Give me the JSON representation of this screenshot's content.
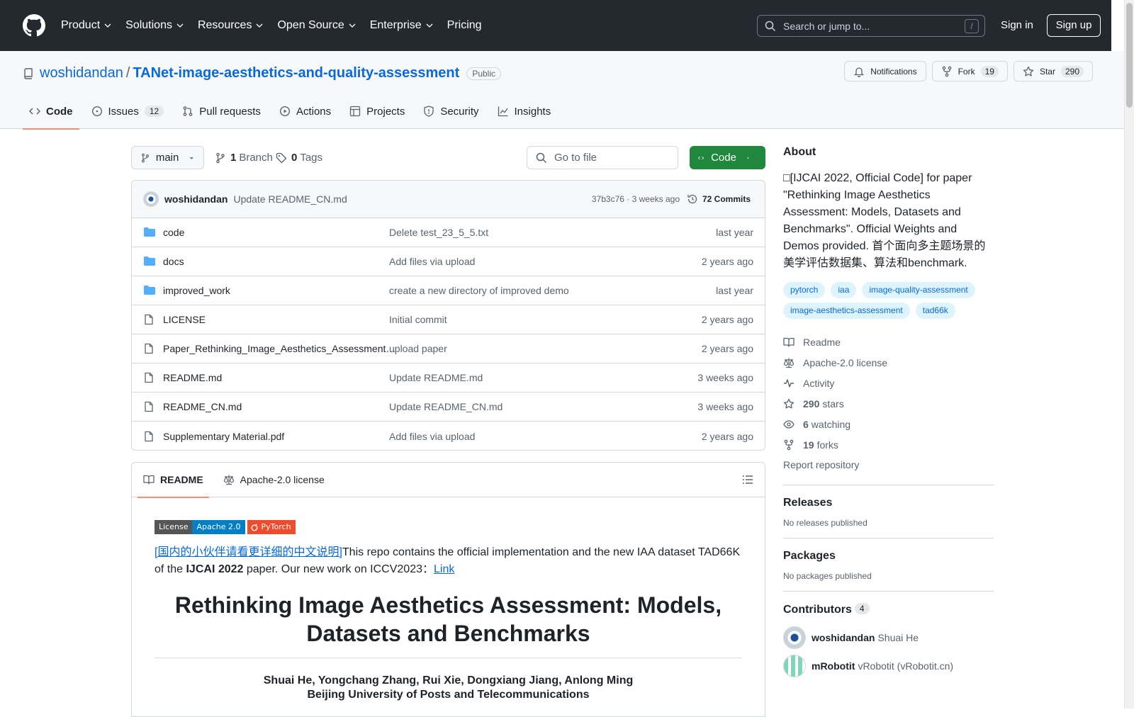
{
  "header": {
    "nav": [
      "Product",
      "Solutions",
      "Resources",
      "Open Source",
      "Enterprise",
      "Pricing"
    ],
    "search_placeholder": "Search or jump to...",
    "search_key": "/",
    "signin": "Sign in",
    "signup": "Sign up"
  },
  "repo": {
    "owner": "woshidandan",
    "separator": "/",
    "name": "TANet-image-aesthetics-and-quality-assessment",
    "visibility": "Public",
    "notifications": "Notifications",
    "fork_label": "Fork",
    "fork_count": "19",
    "star_label": "Star",
    "star_count": "290"
  },
  "tabs": [
    {
      "label": "Code",
      "icon": "code-icon"
    },
    {
      "label": "Issues",
      "count": "12",
      "icon": "issue-icon"
    },
    {
      "label": "Pull requests",
      "icon": "pull-request-icon"
    },
    {
      "label": "Actions",
      "icon": "play-icon"
    },
    {
      "label": "Projects",
      "icon": "table-icon"
    },
    {
      "label": "Security",
      "icon": "shield-icon"
    },
    {
      "label": "Insights",
      "icon": "graph-icon"
    }
  ],
  "toolbar": {
    "branch": "main",
    "branch_count": "1",
    "branch_label": "Branch",
    "tag_count": "0",
    "tag_label": "Tags",
    "goto_placeholder": "Go to file",
    "code_label": "Code"
  },
  "latest_commit": {
    "user": "woshidandan",
    "message": "Update README_CN.md",
    "meta": "37b3c76 · 3 weeks ago",
    "commits": "72 Commits"
  },
  "files": [
    {
      "name": "code",
      "type": "dir",
      "message": "Delete test_23_5_5.txt",
      "time": "last year"
    },
    {
      "name": "docs",
      "type": "dir",
      "message": "Add files via upload",
      "time": "2 years ago"
    },
    {
      "name": "improved_work",
      "type": "dir",
      "message": "create a new directory of improved demo",
      "time": "last year"
    },
    {
      "name": "LICENSE",
      "type": "file",
      "message": "Initial commit",
      "time": "2 years ago"
    },
    {
      "name": "Paper_Rethinking_Image_Aesthetics_Assessment_Models_Datasets_and_Benchmarks.pdf",
      "type": "file",
      "message": "upload paper",
      "time": "2 years ago"
    },
    {
      "name": "README.md",
      "type": "file",
      "message": "Update README.md",
      "time": "3 weeks ago"
    },
    {
      "name": "README_CN.md",
      "type": "file",
      "message": "Update README_CN.md",
      "time": "3 weeks ago"
    },
    {
      "name": "Supplementary Material.pdf",
      "type": "file",
      "message": "Add files via upload",
      "time": "2 years ago"
    }
  ],
  "readme": {
    "tab_readme": "README",
    "tab_license": "Apache-2.0 license",
    "badge_license_l": "License",
    "badge_license_r": "Apache 2.0",
    "badge_pytorch": "PyTorch",
    "intro_link": "[国内的小伙伴请看更详细的中文说明]",
    "intro_text1": "This repo contains the official implementation and the new IAA dataset TAD66K of the ",
    "intro_bold": "IJCAI 2022",
    "intro_text2": " paper. Our new work on ICCV2023：",
    "intro_link2": "Link",
    "title": "Rethinking Image Aesthetics Assessment: Models, Datasets and Benchmarks",
    "authors": "Shuai He, Yongchang Zhang, Rui Xie, Dongxiang Jiang, Anlong Ming",
    "affiliation": "Beijing University of Posts and Telecommunications"
  },
  "about": {
    "heading": "About",
    "description": "□[IJCAI 2022, Official Code] for paper \"Rethinking Image Aesthetics Assessment: Models, Datasets and Benchmarks\". Official Weights and Demos provided. 首个面向多主题场景的美学评估数据集、算法和benchmark.",
    "topics": [
      "pytorch",
      "iaa",
      "image-quality-assessment",
      "image-aesthetics-assessment",
      "tad66k"
    ],
    "readme": "Readme",
    "license": "Apache-2.0 license",
    "activity": "Activity",
    "stars_n": "290",
    "stars_l": "stars",
    "watching_n": "6",
    "watching_l": "watching",
    "forks_n": "19",
    "forks_l": "forks",
    "report": "Report repository"
  },
  "releases": {
    "heading": "Releases",
    "note": "No releases published"
  },
  "packages": {
    "heading": "Packages",
    "note": "No packages published"
  },
  "contributors": {
    "heading": "Contributors",
    "count": "4",
    "list": [
      {
        "login": "woshidandan",
        "name": "Shuai He"
      },
      {
        "login": "mRobotit",
        "name": "vRobotit (vRobotit.cn)"
      }
    ]
  },
  "colors": {
    "header_bg": "#24292f",
    "link": "#0969da",
    "code_btn": "#1f883d",
    "tab_underline": "#fd8c73"
  }
}
